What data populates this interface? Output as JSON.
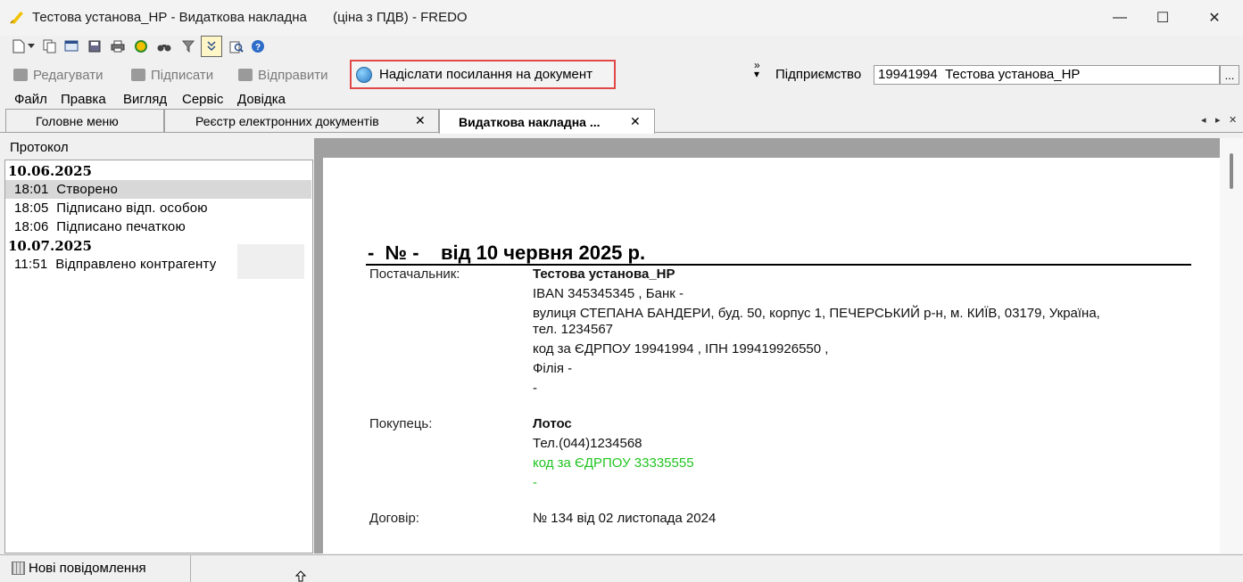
{
  "window": {
    "title": "Тестова установа_НР - Видаткова накладна       (ціна з ПДВ) - FREDO",
    "minimize": "—",
    "maximize": "☐",
    "close": "✕"
  },
  "toolbar2": {
    "edit_label": "Редагувати",
    "sign_label": "Підписати",
    "send_label": "Відправити",
    "send_link_label": "Надіслати посилання на документ",
    "company_label": "Підприємство",
    "company_value": "19941994  Тестова установа_НР",
    "company_button": "...",
    "overflow": "»"
  },
  "menu": [
    "Файл",
    "Правка",
    "Вигляд",
    "Сервіс",
    "Довідка"
  ],
  "tabs": [
    {
      "label": "Головне меню"
    },
    {
      "label": "Реєстр електронних документів"
    },
    {
      "label": "Видаткова накладна ..."
    }
  ],
  "tab_close": "✕",
  "tab_nav": {
    "prev": "◂",
    "next": "▸",
    "close": "✕"
  },
  "protocol": {
    "title": "Протокол",
    "dates": [
      "10.06.2025",
      "10.07.2025"
    ],
    "entries": [
      {
        "time": "18:01",
        "text": "Створено"
      },
      {
        "time": "18:05",
        "text": "Підписано відп. особою"
      },
      {
        "time": "18:06",
        "text": "Підписано печаткою"
      },
      {
        "time": "11:51",
        "text": "Відправлено контрагенту"
      }
    ]
  },
  "document": {
    "heading": "-  № -    від 10 червня 2025 р.",
    "supplier_label": "Постачальник:",
    "supplier_name": "Тестова установа_НР",
    "supplier_iban": "IBAN 345345345 , Банк -",
    "supplier_address": "вулиця СТЕПАНА БАНДЕРИ, буд. 50, корпус 1, ПЕЧЕРСЬКИЙ р-н, м. КИЇВ, 03179, Україна,",
    "supplier_phone": "тел. 1234567",
    "supplier_codes": "код за ЄДРПОУ 19941994 , ІПН 199419926550 ,",
    "supplier_branch": "Філія -",
    "supplier_dash": "-",
    "buyer_label": "Покупець:",
    "buyer_name": "Лотос",
    "buyer_phone": "Тел.(044)1234568",
    "buyer_code": "код за ЄДРПОУ 33335555",
    "buyer_dash": "-",
    "contract_label": "Договір:",
    "contract_value": "№ 134 від 02 листопада 2024"
  },
  "status": {
    "messages_label": "Нові повідомлення"
  },
  "colors": {
    "highlight_border": "#e04848",
    "green_text": "#22c422"
  }
}
